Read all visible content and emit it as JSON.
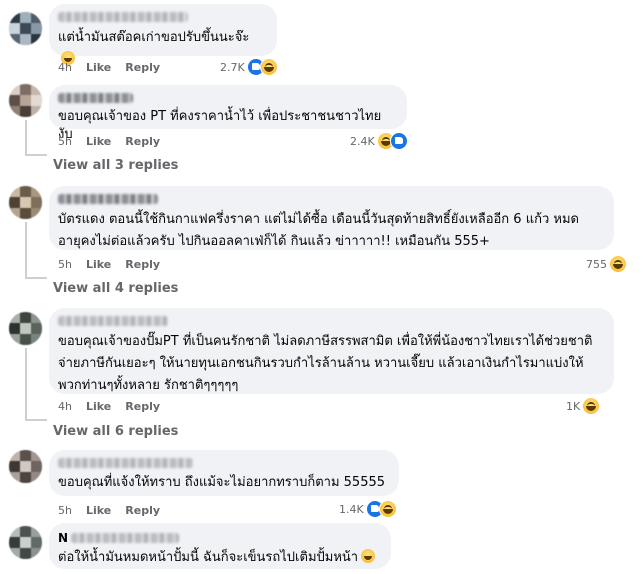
{
  "comments": [
    {
      "text": "แต่น้ำมันสต๊อคเก่าขอปรับขึ้นนะจ๊ะ",
      "emoji": "grinning-squinting-emoji",
      "time": "4h",
      "like": "Like",
      "reply": "Reply",
      "reaction_count": "2.7K",
      "reactions": [
        "like",
        "haha"
      ]
    },
    {
      "text": "ขอบคุณเจ้าของ PT ที่คงราคาน้ำไว้ เพื่อประชาชนชาวไทยงับ",
      "time": "5h",
      "like": "Like",
      "reply": "Reply",
      "reaction_count": "2.4K",
      "reactions": [
        "haha",
        "like"
      ],
      "view_replies": "View all 3 replies"
    },
    {
      "text": "บัตรแดง ตอนนี้ใช้กินกาแฟครึ่งราคา แต่ไม่ได้ซื้อ เดือนนี้วันสุดท้ายสิทธิ์ยังเหลืออีก 6 แก้ว หมด\nอายุคงไม่ต่อแล้วครับ ไปกินออลคาเฟ่ก็ได้ กินแล้ว ข่าาาาา!! เหมือนกัน 555+",
      "time": "5h",
      "like": "Like",
      "reply": "Reply",
      "reaction_count": "755",
      "reactions": [
        "haha"
      ],
      "view_replies": "View all 4 replies"
    },
    {
      "text": "ขอบคุณเจ้าของปั๊มPT ที่เป็นคนรักชาติ ไม่ลดภาษีสรรพสามิต เพื่อให้พี่น้องชาวไทยเราได้ช่วยชาติ\nจ่ายภาษีกันเยอะๆ ให้นายทุนเอกชนกินรวบกำไรล้านล้าน หวานเจี๊ยบ แล้วเอาเงินกำไรมาแบ่งให้\nพวกท่านๆทั้งหลาย รักชาติๆๆๆๆๆ",
      "time": "4h",
      "like": "Like",
      "reply": "Reply",
      "reaction_count": "1K",
      "reactions": [
        "haha"
      ],
      "view_replies": "View all 6 replies"
    },
    {
      "text": "ขอบคุณที่แจ้งให้ทราบ ถึงแม้จะไม่อยากทราบก็ตาม 55555",
      "time": "5h",
      "like": "Like",
      "reply": "Reply",
      "reaction_count": "1.4K",
      "reactions": [
        "like",
        "haha"
      ]
    },
    {
      "name_initial": "N",
      "text": "ต่อให้น้ำมันหมดหน้าปั้มนี้ ฉันก็จะเข็นรถไปเติมปั้มหน้า",
      "emoji": "rolling-laughing-emoji"
    }
  ]
}
